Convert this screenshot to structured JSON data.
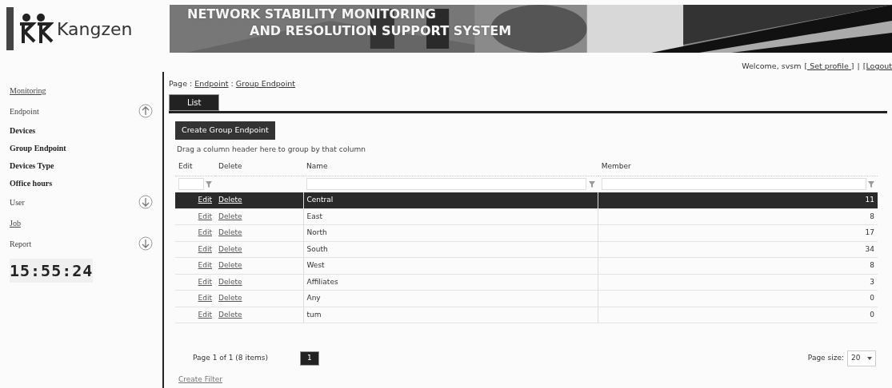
{
  "header": {
    "logo_text": "Kangzen",
    "banner_lines": [
      "NETWORK STABILITY MONITORING",
      "AND RESOLUTION SUPPORT SYSTEM"
    ]
  },
  "user_bar": {
    "welcome": "Welcome, svsm",
    "links": [
      "[ Set profile ]",
      "[Logout"
    ],
    "separator": "|"
  },
  "sidebar": {
    "items": [
      {
        "label": "Monitoring"
      },
      {
        "label": "Endpoint",
        "expanded": true,
        "children": [
          {
            "label": "Devices"
          },
          {
            "label": "Group Endpoint"
          },
          {
            "label": "Devices Type"
          },
          {
            "label": "Office hours"
          }
        ]
      },
      {
        "label": "User",
        "expanded": false
      },
      {
        "label": "Job"
      },
      {
        "label": "Report",
        "expanded": false
      }
    ],
    "clock": "15:55:24"
  },
  "breadcrumb": {
    "prefix": "Page :",
    "separator": ":",
    "links": [
      "Endpoint",
      "Group Endpoint"
    ]
  },
  "tabs": [
    {
      "label": "List",
      "selected": true
    }
  ],
  "create_button": "Create Group Endpoint",
  "group_hint": "Drag a column header here to group by that column",
  "table": {
    "columns": [
      "Edit",
      "Delete",
      "Name",
      "Member"
    ],
    "rows": [
      {
        "edit": "Edit",
        "delete": "Delete",
        "name": "Central",
        "member": "11",
        "selected": true
      },
      {
        "edit": "Edit",
        "delete": "Delete",
        "name": "East",
        "member": "8",
        "selected": false
      },
      {
        "edit": "Edit",
        "delete": "Delete",
        "name": "North",
        "member": "17",
        "selected": false
      },
      {
        "edit": "Edit",
        "delete": "Delete",
        "name": "South",
        "member": "34",
        "selected": false
      },
      {
        "edit": "Edit",
        "delete": "Delete",
        "name": "West",
        "member": "8",
        "selected": false
      },
      {
        "edit": "Edit",
        "delete": "Delete",
        "name": "Affiliates",
        "member": "3",
        "selected": false
      },
      {
        "edit": "Edit",
        "delete": "Delete",
        "name": "Any",
        "member": "0",
        "selected": false
      },
      {
        "edit": "Edit",
        "delete": "Delete",
        "name": "tum",
        "member": "0",
        "selected": false
      }
    ]
  },
  "pager": {
    "summary": "Page 1 of 1 (8 items)",
    "pages": [
      {
        "label": "1",
        "selected": true
      }
    ],
    "page_size_label": "Page size:",
    "page_size": "20"
  },
  "create_filter": "Create Filter"
}
